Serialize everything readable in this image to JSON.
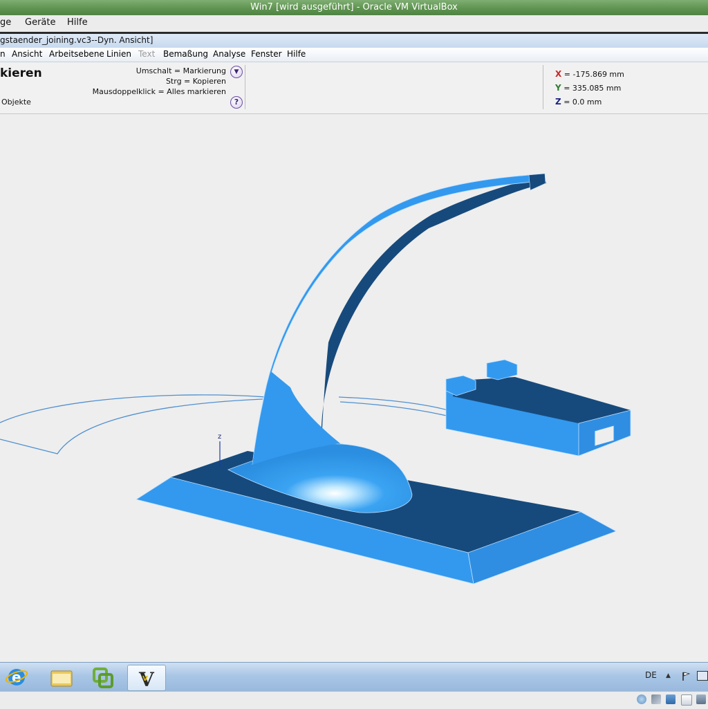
{
  "vbox": {
    "title": "Win7 [wird ausgeführt] - Oracle VM VirtualBox",
    "menu": [
      "ge",
      "Geräte",
      "Hilfe"
    ]
  },
  "app": {
    "title": "gstaender_joining.vc3--Dyn. Ansicht]",
    "menu": [
      "n",
      "Ansicht",
      "Arbeitsebene",
      "Linien",
      "Text",
      "Bemaßung",
      "Analyse",
      "Fenster",
      "Hilfe"
    ]
  },
  "tool": {
    "heading": "kieren",
    "status": "Objekte",
    "hints": [
      "Umschalt = Markierung",
      "Strg = Kopieren",
      "Mausdoppelklick = Alles markieren"
    ],
    "help_glyph": "?",
    "dropdown_glyph": "▼"
  },
  "coords": {
    "x_label": "X",
    "x_value": "= -175.869 mm",
    "y_label": "Y",
    "y_value": "= 335.085 mm",
    "z_label": "Z",
    "z_value": "= 0.0 mm",
    "x_color": "#c62828",
    "y_color": "#2e7d32",
    "z_color": "#1a237e"
  },
  "viewport": {
    "axis_label": "z",
    "model_color": "#3399ee",
    "model_dark": "#174a7c"
  },
  "taskbar": {
    "buttons": [
      "internet-explorer-icon",
      "explorer-folder-icon",
      "vmware-icon",
      "vectorworks-icon"
    ],
    "lang": "DE"
  }
}
